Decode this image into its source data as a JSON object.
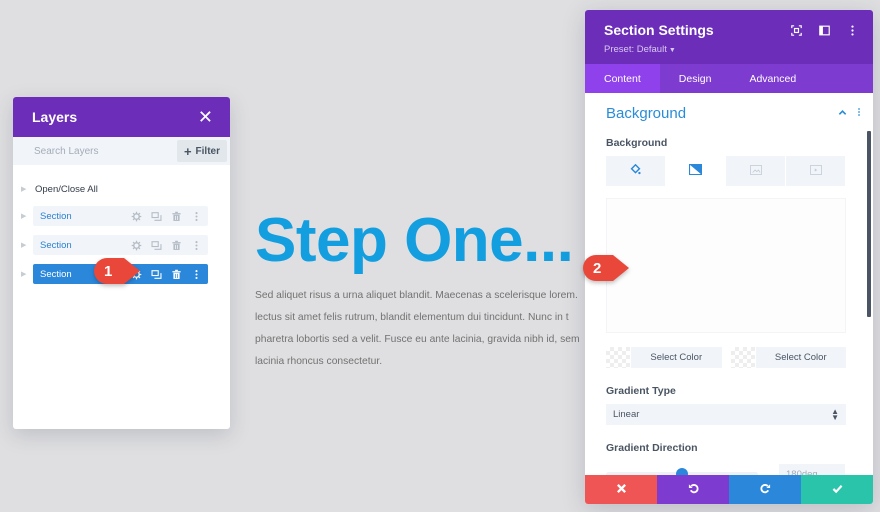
{
  "layers_panel": {
    "title": "Layers",
    "close_icon": "close-icon",
    "search_placeholder": "Search Layers",
    "filter_label": "Filter",
    "open_close_label": "Open/Close All",
    "rows": [
      {
        "label": "Section",
        "active": false
      },
      {
        "label": "Section",
        "active": false
      },
      {
        "label": "Section",
        "active": true
      }
    ],
    "row_actions": [
      "gear-icon",
      "duplicate-icon",
      "trash-icon",
      "more-vertical-icon"
    ]
  },
  "page": {
    "heading": "Step One...",
    "paragraph_lines": [
      "Sed aliquet risus a urna aliquet blandit. Maecenas a scelerisque lorem.",
      "lectus sit amet felis rutrum, blandit elementum dui tincidunt. Nunc in t",
      "pharetra lobortis sed a velit. Fusce eu ante lacinia, gravida nibh id, sem",
      "lacinia rhoncus consectetur."
    ],
    "heading_color": "#139ee0"
  },
  "callouts": [
    {
      "number": "1"
    },
    {
      "number": "2"
    }
  ],
  "settings_panel": {
    "title": "Section Settings",
    "preset_label": "Preset: Default",
    "header_icons": [
      "focus-icon",
      "sidebar-layout-icon",
      "more-vertical-icon"
    ],
    "tabs": [
      {
        "label": "Content",
        "active": true
      },
      {
        "label": "Design",
        "active": false
      },
      {
        "label": "Advanced",
        "active": false
      }
    ],
    "section_title": "Background",
    "background_label": "Background",
    "background_types": [
      {
        "icon": "paint-bucket-icon",
        "active": false
      },
      {
        "icon": "gradient-icon",
        "active": true
      },
      {
        "icon": "image-icon",
        "active": false
      },
      {
        "icon": "video-icon",
        "active": false
      }
    ],
    "color_stops": [
      {
        "label": "Select Color"
      },
      {
        "label": "Select Color"
      }
    ],
    "gradient_type_label": "Gradient Type",
    "gradient_type_value": "Linear",
    "gradient_direction_label": "Gradient Direction",
    "gradient_direction_value": "180deg",
    "gradient_direction_fraction": 0.5,
    "footer_buttons": [
      {
        "icon": "close-icon",
        "color": "#ef5555"
      },
      {
        "icon": "undo-icon",
        "color": "#7e3bd0"
      },
      {
        "icon": "redo-icon",
        "color": "#2b87da"
      },
      {
        "icon": "check-icon",
        "color": "#29c4a9"
      }
    ]
  },
  "colors": {
    "purple": "#6c2eb9",
    "tab_bar": "#7e3bd0",
    "active_blue": "#2b87da",
    "callout_red": "#e8473a"
  }
}
